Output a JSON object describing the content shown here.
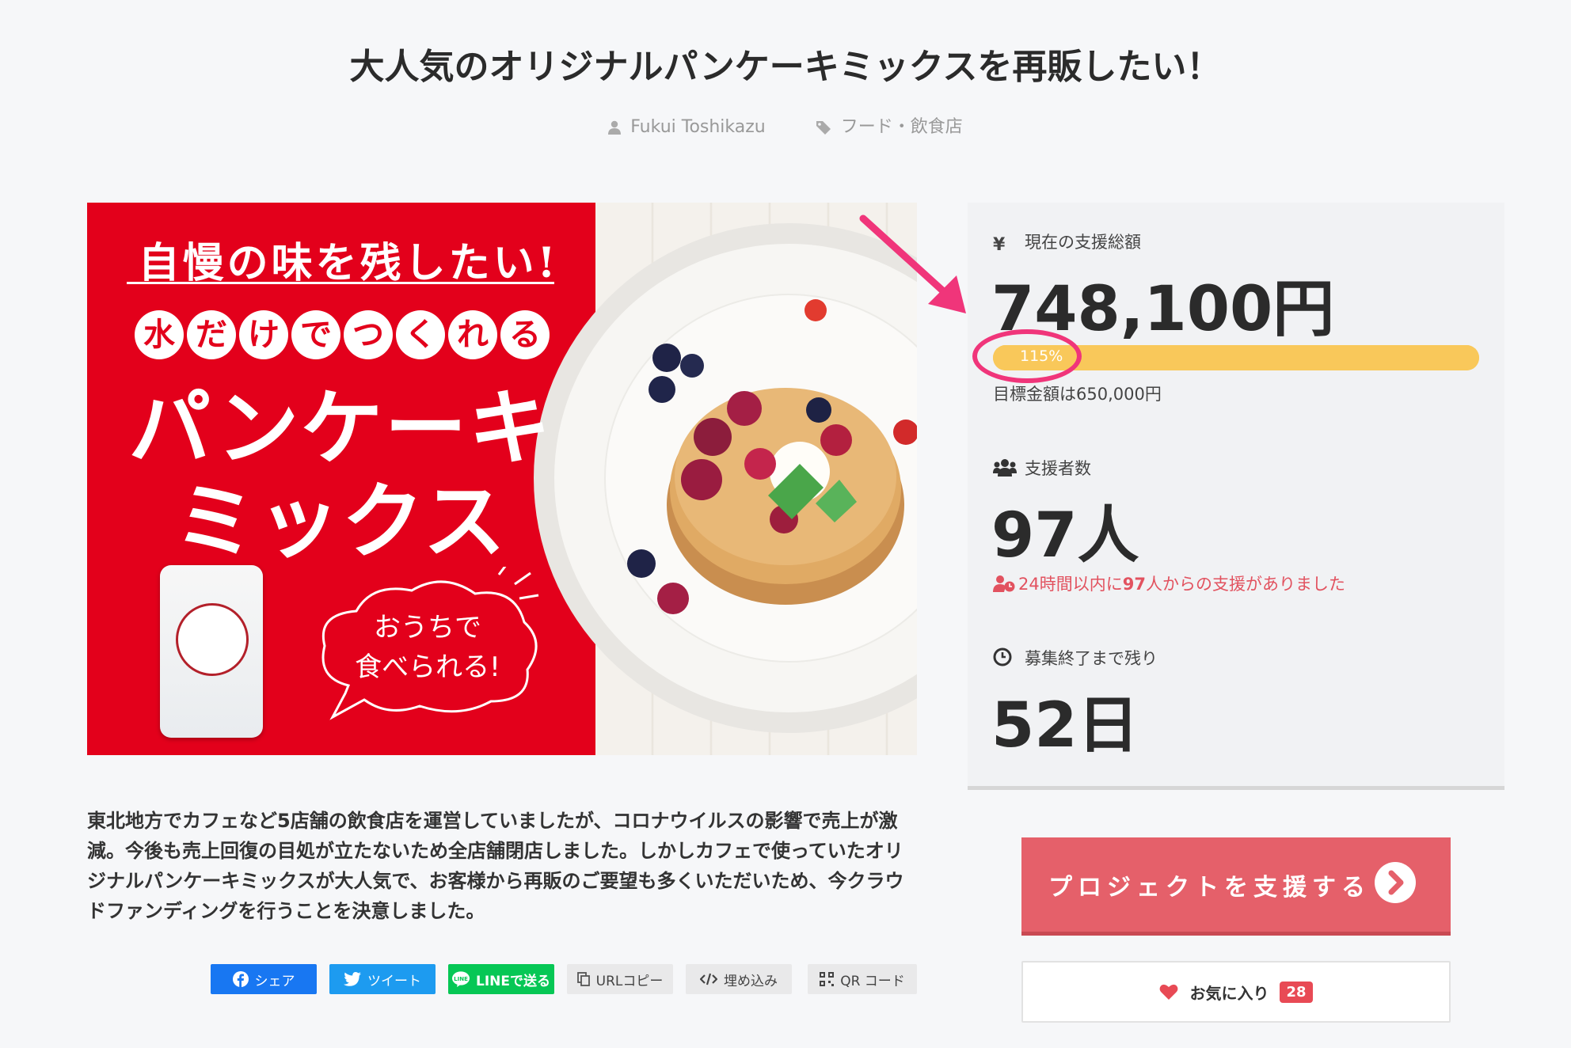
{
  "project": {
    "title": "大人気のオリジナルパンケーキミックスを再販したい！",
    "owner": "Fukui Toshikazu",
    "category": "フード・飲食店"
  },
  "hero": {
    "headline1": "自慢の味を残したい!",
    "bubble_chars": [
      "水",
      "だ",
      "け",
      "で",
      "つ",
      "く",
      "れ",
      "る"
    ],
    "headline2_line1": "パンケーキ",
    "headline2_line2": "ミックス",
    "speech_line1": "おうちで",
    "speech_line2": "食べられる!"
  },
  "stats": {
    "total_label": "現在の支援総額",
    "total_amount": "748,100円",
    "progress_text": "115%",
    "progress_fraction": 1.0,
    "goal_text": "目標金額は650,000円",
    "backers_label": "支援者数",
    "backers_count": "97人",
    "recent_prefix": "24時間以内に",
    "recent_count": "97",
    "recent_suffix": "人からの支援がありました",
    "remaining_label": "募集終了まで残り",
    "remaining_days": "52日"
  },
  "description": "東北地方でカフェなど5店舗の飲食店を運営していましたが、コロナウイルスの影響で売上が激減。今後も売上回復の目処が立たないため全店舗閉店しました。しかしカフェで使っていたオリジナルパンケーキミックスが大人気で、お客様から再販のご要望も多くいただいため、今クラウドファンディングを行うことを決意しました。",
  "share": {
    "facebook": "シェア",
    "twitter": "ツイート",
    "line": "LINEで送る",
    "url_copy": "URLコピー",
    "embed": "埋め込み",
    "qr": "QR コード"
  },
  "actions": {
    "support_label": "プロジェクトを支援する",
    "favorite_label": "お気に入り",
    "favorite_count": "28"
  },
  "colors": {
    "accent": "#e5606a",
    "progress": "#f9c85a",
    "highlight": "#f0357a",
    "hero_red": "#e3001b"
  }
}
